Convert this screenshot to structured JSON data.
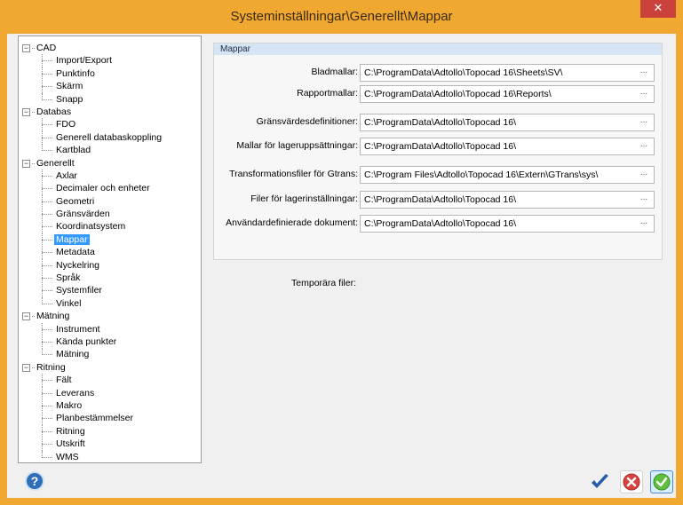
{
  "window": {
    "title": "Systeminställningar\\Generellt\\Mappar"
  },
  "tree": [
    {
      "label": "CAD",
      "level": 0,
      "toggle": "⊟"
    },
    {
      "label": "Import/Export",
      "level": 1
    },
    {
      "label": "Punktinfo",
      "level": 1
    },
    {
      "label": "Skärm",
      "level": 1
    },
    {
      "label": "Snapp",
      "level": 1
    },
    {
      "label": "Databas",
      "level": 0,
      "toggle": "⊟"
    },
    {
      "label": "FDO",
      "level": 1
    },
    {
      "label": "Generell databaskoppling",
      "level": 1
    },
    {
      "label": "Kartblad",
      "level": 1
    },
    {
      "label": "Generellt",
      "level": 0,
      "toggle": "⊟"
    },
    {
      "label": "Axlar",
      "level": 1
    },
    {
      "label": "Decimaler och enheter",
      "level": 1
    },
    {
      "label": "Geometri",
      "level": 1
    },
    {
      "label": "Gränsvärden",
      "level": 1
    },
    {
      "label": "Koordinatsystem",
      "level": 1
    },
    {
      "label": "Mappar",
      "level": 1,
      "selected": true
    },
    {
      "label": "Metadata",
      "level": 1
    },
    {
      "label": "Nyckelring",
      "level": 1
    },
    {
      "label": "Språk",
      "level": 1
    },
    {
      "label": "Systemfiler",
      "level": 1
    },
    {
      "label": "Vinkel",
      "level": 1
    },
    {
      "label": "Mätning",
      "level": 0,
      "toggle": "⊟"
    },
    {
      "label": "Instrument",
      "level": 1
    },
    {
      "label": "Kända punkter",
      "level": 1
    },
    {
      "label": "Mätning",
      "level": 1
    },
    {
      "label": "Ritning",
      "level": 0,
      "toggle": "⊟"
    },
    {
      "label": "Fält",
      "level": 1
    },
    {
      "label": "Leverans",
      "level": 1
    },
    {
      "label": "Makro",
      "level": 1
    },
    {
      "label": "Planbestämmelser",
      "level": 1
    },
    {
      "label": "Ritning",
      "level": 1
    },
    {
      "label": "Utskrift",
      "level": 1
    },
    {
      "label": "WMS",
      "level": 1
    }
  ],
  "panel": {
    "header": "Mappar",
    "fields": [
      {
        "label": "Bladmallar:",
        "value": "C:\\ProgramData\\Adtollo\\Topocad 16\\Sheets\\SV\\"
      },
      {
        "label": "Rapportmallar:",
        "value": "C:\\ProgramData\\Adtollo\\Topocad 16\\Reports\\"
      },
      {
        "label": "Gränsvärdesdefinitioner:",
        "value": "C:\\ProgramData\\Adtollo\\Topocad 16\\"
      },
      {
        "label": "Mallar för lageruppsättningar:",
        "value": "C:\\ProgramData\\Adtollo\\Topocad 16\\"
      },
      {
        "label": "Transformationsfiler för Gtrans:",
        "value": "C:\\Program Files\\Adtollo\\Topocad 16\\Extern\\GTrans\\sys\\"
      },
      {
        "label": "Filer för lagerinställningar:",
        "value": "C:\\ProgramData\\Adtollo\\Topocad 16\\"
      },
      {
        "label": "Användardefinierade dokument:",
        "value": "C:\\ProgramData\\Adtollo\\Topocad 16\\"
      }
    ],
    "temp_label": "Temporära filer:",
    "browse_label": "..."
  },
  "footer": {
    "help_label": "?",
    "ok_icon": "checkmark-icon",
    "cancel_icon": "cancel-x-icon",
    "apply_icon": "apply-check-icon"
  },
  "colors": {
    "frame": "#f0a830",
    "close": "#c9413a",
    "selection": "#3399ff",
    "panel_header": "#d6e5f5"
  }
}
